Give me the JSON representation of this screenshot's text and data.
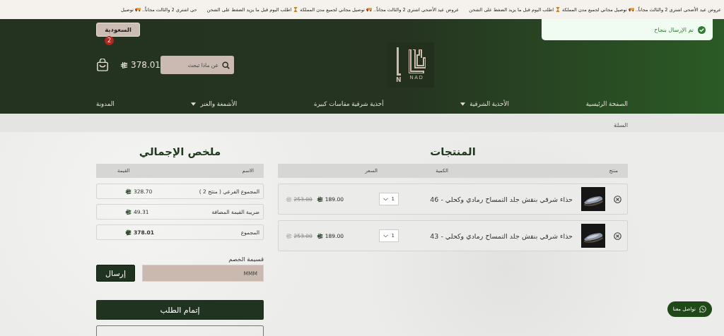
{
  "ticker": [
    {
      "parts": [
        "عروض عيد الأضحى اشتري 2 والثالث مجاناً..",
        "توصيل مجاني لجميع مدن المملكة",
        "اطلب اليوم قبل ما يزيد الضغط على الشحن"
      ]
    },
    {
      "parts": [
        "عروض عيد الأضحى اشتري 2 والثالث مجاناً..",
        "توصيل مجاني لجميع مدن المملكة",
        "اطلب اليوم قبل ما يزيد الضغط على الشحن"
      ]
    },
    {
      "parts": [
        "حى اشتري 2 والثالث مجاناً..",
        "توصيل"
      ]
    }
  ],
  "header": {
    "country": "السعودية",
    "cart_count": "2",
    "cart_total": "378.01",
    "search": {
      "placeholder": "عن ماذا تبحث"
    },
    "logo": {
      "mark": "NAD",
      "letter": "N"
    },
    "nav": [
      {
        "label": "الصفحة الرئيسية",
        "dropdown": false
      },
      {
        "label": "الأحذية الشرقية",
        "dropdown": true
      },
      {
        "label": "أحذية شرقية مقاسات كبيرة",
        "dropdown": false
      },
      {
        "label": "الأشمغة والغتر",
        "dropdown": true
      },
      {
        "label": "المدونة",
        "dropdown": false
      }
    ]
  },
  "toast": {
    "message": "تم الإرسال بنجاح"
  },
  "breadcrumb": "السلة",
  "products": {
    "title": "المنتجات",
    "columns": [
      "منتج",
      "الكمية",
      "السعر"
    ],
    "rows": [
      {
        "name": "حذاء شرقي بنقش جلد التمساح رمادي وكحلي - 46",
        "qty": "1",
        "price": "189.00",
        "old_price": "253.00"
      },
      {
        "name": "حذاء شرقي بنقش جلد التمساح رمادي وكحلي - 43",
        "qty": "1",
        "price": "189.00",
        "old_price": "253.00"
      }
    ]
  },
  "summary": {
    "title": "ملخص الإجمالي",
    "columns": [
      "الاسم",
      "القيمة"
    ],
    "rows": [
      {
        "name": "المجموع الفرعي ( منتج 2 )",
        "value": "328.70",
        "bold": false
      },
      {
        "name": "ضريبة القيمة المضافة",
        "value": "49.31",
        "bold": false
      },
      {
        "name": "المجموع",
        "value": "378.01",
        "bold": true
      }
    ],
    "coupon": {
      "label": "قسيمة الخصم",
      "value": "MMM",
      "button": "إرسال"
    },
    "checkout": "إتمام الطلب"
  },
  "contact": "تواصل معنا"
}
